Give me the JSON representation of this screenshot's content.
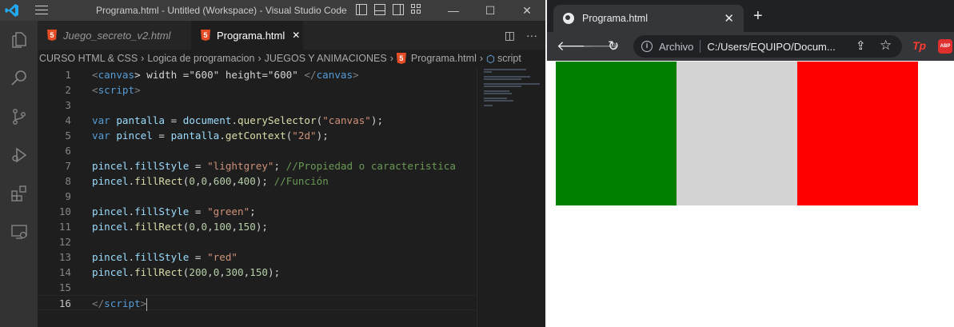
{
  "vscode": {
    "window_title": "Programa.html - Untitled (Workspace) - Visual Studio Code",
    "tabs": [
      {
        "label": "Juego_secreto_v2.html",
        "icon": "html5-icon",
        "active": false,
        "italic": true
      },
      {
        "label": "Programa.html",
        "icon": "html5-icon",
        "active": true,
        "close": "✕"
      }
    ],
    "breadcrumb": [
      "CURSO HTML & CSS",
      "Logica de programacion",
      "JUEGOS Y ANIMACIONES",
      "Programa.html",
      "script"
    ],
    "current_line": 16,
    "code_lines": [
      {
        "n": "1",
        "tokens": [
          {
            "t": "<",
            "c": "#808080"
          },
          {
            "t": "canvas",
            "c": "#569cd6"
          },
          {
            "t": "> width =\"600\" height=\"600\" ",
            "c": "#d4d4d4"
          },
          {
            "t": "</",
            "c": "#808080"
          },
          {
            "t": "canvas",
            "c": "#569cd6"
          },
          {
            "t": ">",
            "c": "#808080"
          }
        ]
      },
      {
        "n": "2",
        "tokens": [
          {
            "t": "<",
            "c": "#808080"
          },
          {
            "t": "script",
            "c": "#569cd6"
          },
          {
            "t": ">",
            "c": "#808080"
          }
        ]
      },
      {
        "n": "3",
        "tokens": []
      },
      {
        "n": "4",
        "tokens": [
          {
            "t": "var ",
            "c": "#569cd6"
          },
          {
            "t": "pantalla",
            "c": "#9cdcfe"
          },
          {
            "t": " = ",
            "c": "#d4d4d4"
          },
          {
            "t": "document",
            "c": "#9cdcfe"
          },
          {
            "t": ".",
            "c": "#d4d4d4"
          },
          {
            "t": "querySelector",
            "c": "#dcdcaa"
          },
          {
            "t": "(",
            "c": "#d4d4d4"
          },
          {
            "t": "\"canvas\"",
            "c": "#ce9178"
          },
          {
            "t": ");",
            "c": "#d4d4d4"
          }
        ]
      },
      {
        "n": "5",
        "tokens": [
          {
            "t": "var ",
            "c": "#569cd6"
          },
          {
            "t": "pincel",
            "c": "#9cdcfe"
          },
          {
            "t": " = ",
            "c": "#d4d4d4"
          },
          {
            "t": "pantalla",
            "c": "#9cdcfe"
          },
          {
            "t": ".",
            "c": "#d4d4d4"
          },
          {
            "t": "getContext",
            "c": "#dcdcaa"
          },
          {
            "t": "(",
            "c": "#d4d4d4"
          },
          {
            "t": "\"2d\"",
            "c": "#ce9178"
          },
          {
            "t": ");",
            "c": "#d4d4d4"
          }
        ]
      },
      {
        "n": "6",
        "tokens": []
      },
      {
        "n": "7",
        "tokens": [
          {
            "t": "pincel",
            "c": "#9cdcfe"
          },
          {
            "t": ".",
            "c": "#d4d4d4"
          },
          {
            "t": "fillStyle",
            "c": "#9cdcfe"
          },
          {
            "t": " = ",
            "c": "#d4d4d4"
          },
          {
            "t": "\"lightgrey\"",
            "c": "#ce9178"
          },
          {
            "t": "; ",
            "c": "#d4d4d4"
          },
          {
            "t": "//Propiedad o caracteristica",
            "c": "#6a9955"
          }
        ]
      },
      {
        "n": "8",
        "tokens": [
          {
            "t": "pincel",
            "c": "#9cdcfe"
          },
          {
            "t": ".",
            "c": "#d4d4d4"
          },
          {
            "t": "fillRect",
            "c": "#dcdcaa"
          },
          {
            "t": "(",
            "c": "#d4d4d4"
          },
          {
            "t": "0",
            "c": "#b5cea8"
          },
          {
            "t": ",",
            "c": "#d4d4d4"
          },
          {
            "t": "0",
            "c": "#b5cea8"
          },
          {
            "t": ",",
            "c": "#d4d4d4"
          },
          {
            "t": "600",
            "c": "#b5cea8"
          },
          {
            "t": ",",
            "c": "#d4d4d4"
          },
          {
            "t": "400",
            "c": "#b5cea8"
          },
          {
            "t": "); ",
            "c": "#d4d4d4"
          },
          {
            "t": "//Función",
            "c": "#6a9955"
          }
        ]
      },
      {
        "n": "9",
        "tokens": []
      },
      {
        "n": "10",
        "tokens": [
          {
            "t": "pincel",
            "c": "#9cdcfe"
          },
          {
            "t": ".",
            "c": "#d4d4d4"
          },
          {
            "t": "fillStyle",
            "c": "#9cdcfe"
          },
          {
            "t": " = ",
            "c": "#d4d4d4"
          },
          {
            "t": "\"green\"",
            "c": "#ce9178"
          },
          {
            "t": ";",
            "c": "#d4d4d4"
          }
        ]
      },
      {
        "n": "11",
        "tokens": [
          {
            "t": "pincel",
            "c": "#9cdcfe"
          },
          {
            "t": ".",
            "c": "#d4d4d4"
          },
          {
            "t": "fillRect",
            "c": "#dcdcaa"
          },
          {
            "t": "(",
            "c": "#d4d4d4"
          },
          {
            "t": "0",
            "c": "#b5cea8"
          },
          {
            "t": ",",
            "c": "#d4d4d4"
          },
          {
            "t": "0",
            "c": "#b5cea8"
          },
          {
            "t": ",",
            "c": "#d4d4d4"
          },
          {
            "t": "100",
            "c": "#b5cea8"
          },
          {
            "t": ",",
            "c": "#d4d4d4"
          },
          {
            "t": "150",
            "c": "#b5cea8"
          },
          {
            "t": ");",
            "c": "#d4d4d4"
          }
        ]
      },
      {
        "n": "12",
        "tokens": []
      },
      {
        "n": "13",
        "tokens": [
          {
            "t": "pincel",
            "c": "#9cdcfe"
          },
          {
            "t": ".",
            "c": "#d4d4d4"
          },
          {
            "t": "fillStyle",
            "c": "#9cdcfe"
          },
          {
            "t": " = ",
            "c": "#d4d4d4"
          },
          {
            "t": "\"red\"",
            "c": "#ce9178"
          }
        ]
      },
      {
        "n": "14",
        "tokens": [
          {
            "t": "pincel",
            "c": "#9cdcfe"
          },
          {
            "t": ".",
            "c": "#d4d4d4"
          },
          {
            "t": "fillRect",
            "c": "#dcdcaa"
          },
          {
            "t": "(",
            "c": "#d4d4d4"
          },
          {
            "t": "200",
            "c": "#b5cea8"
          },
          {
            "t": ",",
            "c": "#d4d4d4"
          },
          {
            "t": "0",
            "c": "#b5cea8"
          },
          {
            "t": ",",
            "c": "#d4d4d4"
          },
          {
            "t": "300",
            "c": "#b5cea8"
          },
          {
            "t": ",",
            "c": "#d4d4d4"
          },
          {
            "t": "150",
            "c": "#b5cea8"
          },
          {
            "t": ");",
            "c": "#d4d4d4"
          }
        ]
      },
      {
        "n": "15",
        "tokens": []
      },
      {
        "n": "16",
        "tokens": [
          {
            "t": "</",
            "c": "#808080"
          },
          {
            "t": "script",
            "c": "#569cd6"
          },
          {
            "t": ">",
            "c": "#808080"
          }
        ]
      }
    ]
  },
  "browser": {
    "tab_title": "Programa.html",
    "tab_close": "✕",
    "new_tab": "+",
    "address_label": "Archivo",
    "address_url": "C:/Users/EQUIPO/Docum...",
    "extension_tp": "Tp",
    "extension_abp": "ABP",
    "page_canvas": {
      "colors": {
        "background": "lightgrey",
        "left": "green",
        "right": "red"
      },
      "visible_fraction": {
        "green_width": 0.333,
        "red_start": 0.667
      }
    }
  }
}
